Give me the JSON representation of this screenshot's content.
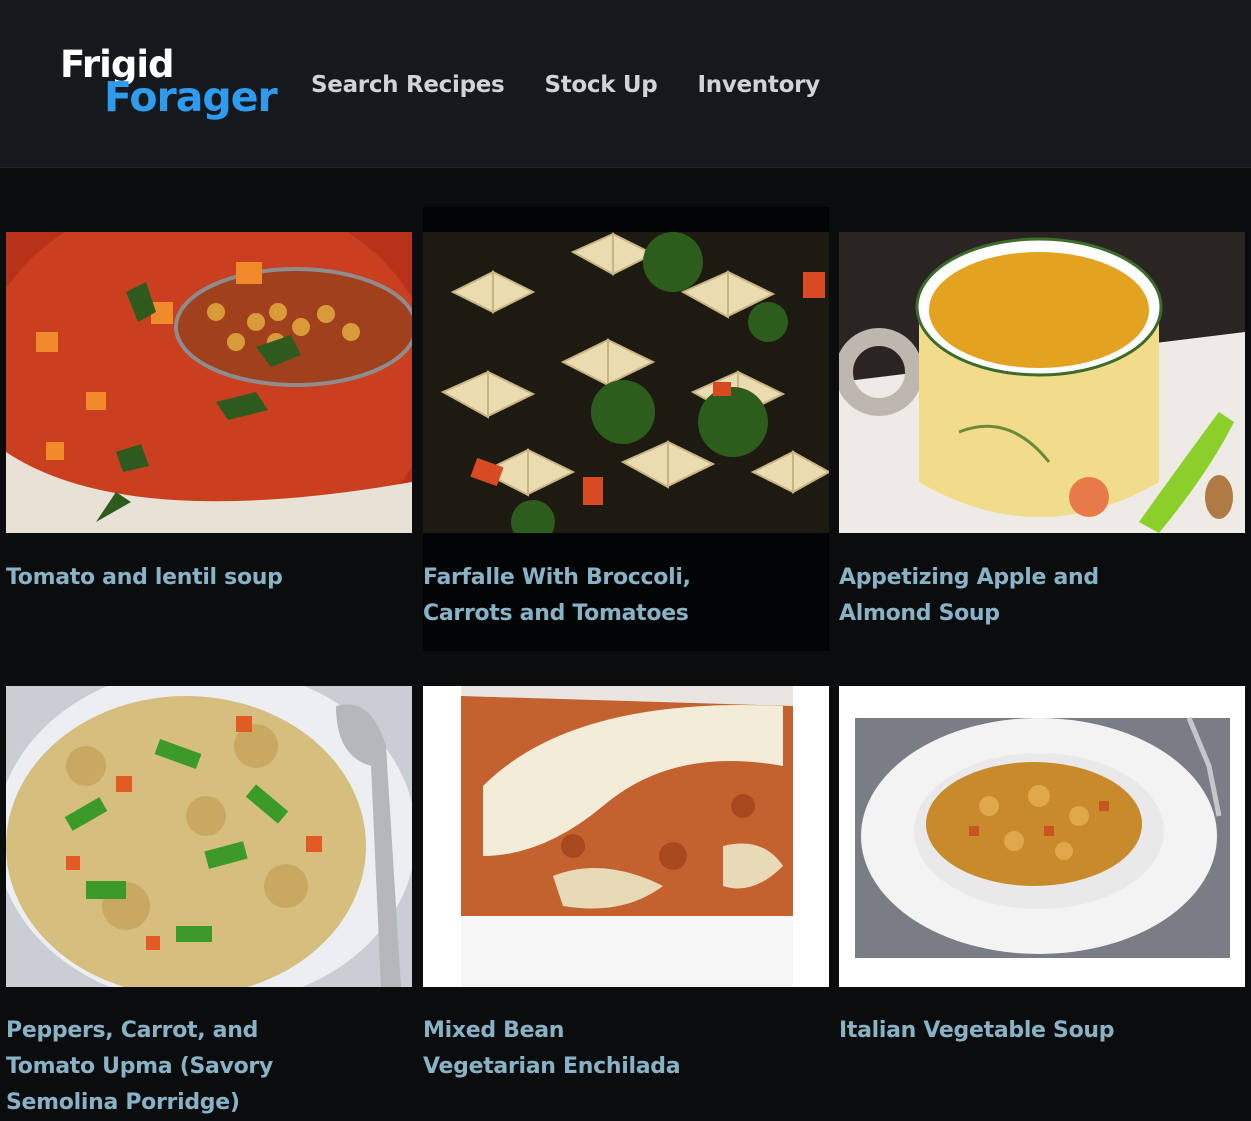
{
  "app": {
    "logo_line1": "Frigid",
    "logo_line2": "Forager",
    "colors": {
      "header_bg": "#16191c",
      "page_bg": "#0b0c0e",
      "logo_accent": "#2e9bef",
      "title_color": "#88b3c6"
    }
  },
  "nav": {
    "items": [
      {
        "label": "Search Recipes"
      },
      {
        "label": "Stock Up"
      },
      {
        "label": "Inventory"
      }
    ]
  },
  "recipes": [
    {
      "title": "Tomato and lentil soup",
      "image": "tomato-lentil-soup-photo"
    },
    {
      "title": "Farfalle With Broccoli, Carrots and Tomatoes",
      "image": "farfalle-pasta-photo"
    },
    {
      "title": "Appetizing Apple and Almond Soup",
      "image": "apple-almond-soup-photo"
    },
    {
      "title": "Peppers, Carrot, and Tomato Upma (Savory Semolina Porridge)",
      "image": "upma-photo"
    },
    {
      "title": "Mixed Bean Vegetarian Enchilada",
      "image": "enchilada-photo"
    },
    {
      "title": "Italian Vegetable Soup",
      "image": "italian-vegetable-soup-photo"
    }
  ]
}
